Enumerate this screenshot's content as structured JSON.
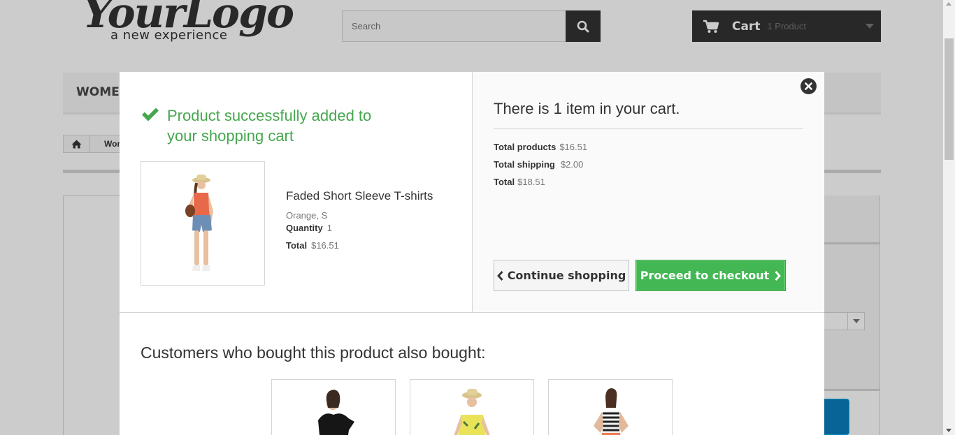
{
  "header": {
    "logo_word": "YourLogo",
    "logo_tagline": "a new experience",
    "search_placeholder": "Search",
    "cart_title": "Cart",
    "cart_quantity": "1 Product"
  },
  "menu": {
    "first_item": "WOMEN"
  },
  "breadcrumb": {
    "current": "Wom"
  },
  "modal": {
    "success_message": "Product successfully added to your shopping cart",
    "product": {
      "name": "Faded Short Sleeve T-shirts",
      "attributes": "Orange, S",
      "quantity_label": "Quantity",
      "quantity_value": "1",
      "total_label": "Total",
      "total_value": "$16.51"
    },
    "cart_summary": {
      "heading": "There is 1 item in your cart.",
      "total_products_label": "Total products",
      "total_products_value": "$16.51",
      "total_shipping_label": "Total shipping",
      "total_shipping_value": "$2.00",
      "total_label": "Total",
      "total_value": "$18.51"
    },
    "continue_label": "Continue shopping",
    "checkout_label": "Proceed to checkout",
    "cross_sell_title": "Customers who bought this product also bought:"
  },
  "colors": {
    "success_green": "#46a74e",
    "checkout_green": "#43b754",
    "dark": "#333333"
  },
  "icons": [
    "search-icon",
    "shopping-cart-icon",
    "chevron-down-icon",
    "home-icon",
    "close-icon",
    "checkmark-icon",
    "chevron-left-icon",
    "chevron-right-icon"
  ]
}
